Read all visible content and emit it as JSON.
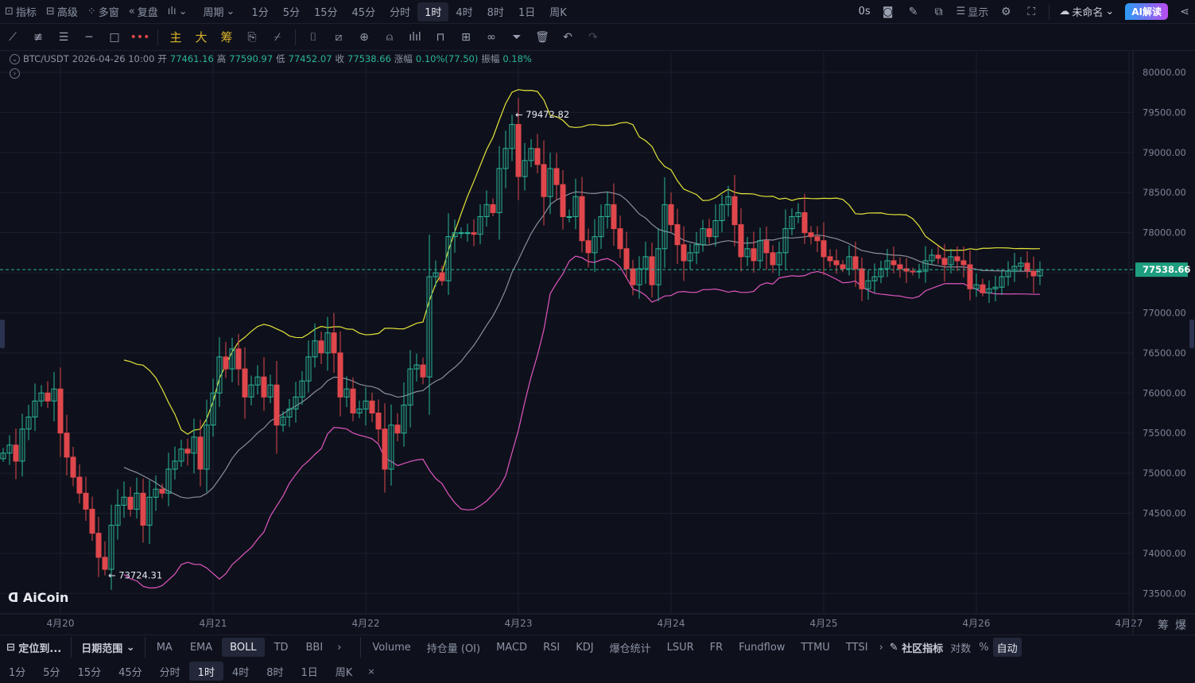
{
  "topbar": {
    "left": [
      {
        "label": "指标",
        "icon": "chart-icon"
      },
      {
        "label": "高级",
        "icon": "panel-icon"
      },
      {
        "label": "多窗",
        "icon": "grid-icon"
      },
      {
        "label": "复盘",
        "icon": "rewind-icon"
      }
    ],
    "period_label": "周期",
    "periods": [
      "1分",
      "5分",
      "15分",
      "45分",
      "分时",
      "1时",
      "4时",
      "8时",
      "1日",
      "周K"
    ],
    "active_period": "1时",
    "countdown": "0s",
    "display_label": "显示",
    "layout_name": "未命名",
    "ai_label": "AI解读"
  },
  "toolbar": {
    "main": "主",
    "big": "大",
    "chips": "筹"
  },
  "info": {
    "symbol": "BTC/USDT",
    "time": "2026-04-26 10:00",
    "open_label": "开",
    "open": "77461.16",
    "high_label": "高",
    "high": "77590.97",
    "low_label": "低",
    "low": "77452.07",
    "close_label": "收",
    "close": "77538.66",
    "change_label": "涨幅",
    "change": "0.10%(77.50)",
    "amp_label": "振幅",
    "amp": "0.18%"
  },
  "watermark": "AiCoin",
  "bottom": {
    "locate": "定位到...",
    "date_range": "日期范围",
    "indicators": [
      "MA",
      "EMA",
      "BOLL",
      "TD",
      "BBI"
    ],
    "active_indicator": "BOLL",
    "sub_indicators": [
      "Volume",
      "持仓量 (OI)",
      "MACD",
      "RSI",
      "KDJ",
      "爆仓统计",
      "LSUR",
      "FR",
      "Fundflow",
      "TTMU",
      "TTSI"
    ],
    "community": "社区指标",
    "log": "对数",
    "percent": "%",
    "auto": "自动",
    "axis_extra": [
      "筹",
      "爆"
    ],
    "periods": [
      "1分",
      "5分",
      "15分",
      "45分",
      "分时",
      "1时",
      "4时",
      "8时",
      "1日",
      "周K"
    ],
    "active_period": "1时",
    "close": "×"
  },
  "colors": {
    "up": "#2bb59a",
    "down": "#e0474c",
    "boll_upper": "#e4e43a",
    "boll_mid": "#8a8f9c",
    "boll_lower": "#e055c0",
    "bg": "#0e111b"
  },
  "chart_data": {
    "type": "candlestick",
    "symbol": "BTC/USDT",
    "interval": "1h",
    "first_candle": "2026-04-19 15:00",
    "open_rule": "open equals previous close",
    "first_open": 75180,
    "closes": [
      75250,
      75350,
      75150,
      75550,
      75700,
      75900,
      76000,
      75900,
      76050,
      75500,
      75200,
      74950,
      74750,
      74550,
      74250,
      73950,
      73800,
      74350,
      74600,
      74700,
      74550,
      74750,
      74350,
      74700,
      74800,
      74750,
      75050,
      75150,
      75300,
      75250,
      75450,
      75050,
      75600,
      76000,
      76450,
      76300,
      76550,
      76300,
      75950,
      76100,
      76200,
      75950,
      76100,
      75600,
      75700,
      75800,
      75950,
      76150,
      76450,
      76650,
      76500,
      76750,
      76500,
      75950,
      76050,
      75750,
      75800,
      75900,
      75750,
      75550,
      75050,
      75600,
      75500,
      75850,
      76300,
      76350,
      76200,
      77450,
      77500,
      77400,
      77950,
      78000,
      78000,
      78000,
      77980,
      78200,
      78350,
      78250,
      78800,
      79050,
      79350,
      78700,
      78900,
      79050,
      78850,
      78450,
      78800,
      78600,
      78200,
      78200,
      78450,
      77900,
      77750,
      77950,
      78200,
      78350,
      78050,
      77800,
      77550,
      77350,
      77550,
      77700,
      77350,
      77800,
      78350,
      78100,
      77850,
      77650,
      77750,
      77850,
      78050,
      77950,
      78150,
      78350,
      78450,
      78100,
      77700,
      77800,
      77650,
      77900,
      77750,
      77600,
      77750,
      78050,
      78200,
      78250,
      78000,
      77950,
      77900,
      77700,
      77650,
      77600,
      77550,
      77700,
      77550,
      77300,
      77400,
      77450,
      77550,
      77650,
      77600,
      77550,
      77520,
      77510,
      77520,
      77650,
      77720,
      77680,
      77600,
      77700,
      77650,
      77600,
      77300,
      77350,
      77250,
      77300,
      77320,
      77450,
      77520,
      77580,
      77620,
      77520,
      77461.16,
      77538.66
    ],
    "ylim": [
      73245,
      80258
    ],
    "y_ticks": [
      "80000.00",
      "79500.00",
      "79000.00",
      "78500.00",
      "78000.00",
      "77500.00",
      "77000.00",
      "76500.00",
      "76000.00",
      "75500.00",
      "75000.00",
      "74500.00",
      "74000.00",
      "73500.00"
    ],
    "x_labels": [
      {
        "label": "4月20",
        "index": 9
      },
      {
        "label": "4月21",
        "index": 33
      },
      {
        "label": "4月22",
        "index": 57
      },
      {
        "label": "4月23",
        "index": 81
      },
      {
        "label": "4月24",
        "index": 105
      },
      {
        "label": "4月25",
        "index": 129
      },
      {
        "label": "4月26",
        "index": 153
      },
      {
        "label": "4月27",
        "index": 177
      }
    ],
    "indicator": "BOLL(20,2)",
    "high_marker": {
      "label": "← 79472.82",
      "value": 79472.82,
      "index": 80
    },
    "low_marker": {
      "label": "← 73724.31",
      "value": 73724.31,
      "index": 16
    },
    "last_price": {
      "label": "77538.66",
      "value": 77538.66
    }
  }
}
